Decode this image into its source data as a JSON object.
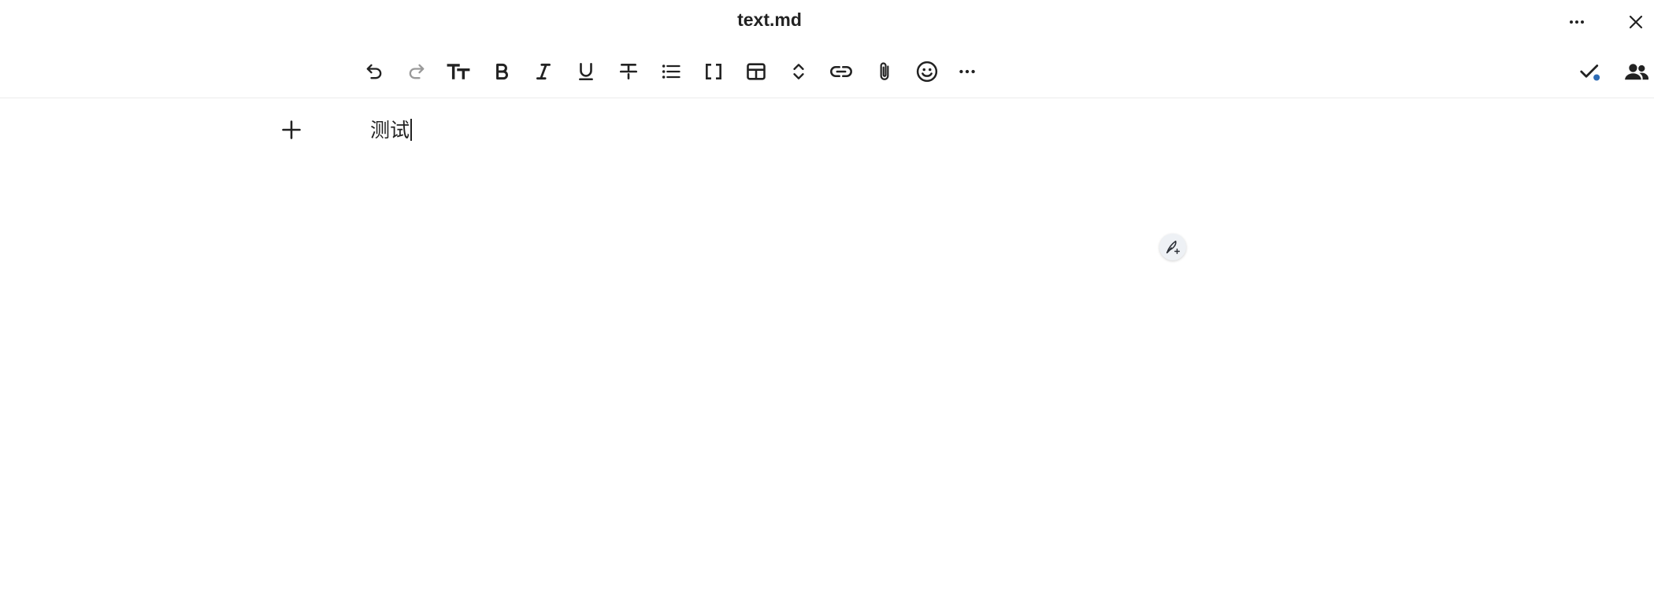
{
  "header": {
    "title": "text.md",
    "more_icon": "more-horizontal-icon",
    "close_icon": "close-icon"
  },
  "toolbar": {
    "items": [
      {
        "name": "undo",
        "icon": "undo-icon"
      },
      {
        "name": "redo",
        "icon": "redo-icon",
        "disabled": true
      },
      {
        "name": "headings",
        "icon": "text-size-icon"
      },
      {
        "name": "bold",
        "icon": "bold-icon"
      },
      {
        "name": "italic",
        "icon": "italic-icon"
      },
      {
        "name": "underline",
        "icon": "underline-icon"
      },
      {
        "name": "strikethrough",
        "icon": "strikethrough-icon"
      },
      {
        "name": "bullet-list",
        "icon": "list-icon"
      },
      {
        "name": "code-block",
        "icon": "brackets-icon"
      },
      {
        "name": "table",
        "icon": "table-icon"
      },
      {
        "name": "expand",
        "icon": "chevron-up-down-icon"
      },
      {
        "name": "link",
        "icon": "link-icon"
      },
      {
        "name": "attachment",
        "icon": "paperclip-icon"
      },
      {
        "name": "emoji",
        "icon": "emoji-icon"
      },
      {
        "name": "more",
        "icon": "more-horizontal-icon"
      }
    ],
    "status_icon": "check-sync-icon",
    "users_icon": "users-icon"
  },
  "editor": {
    "content": "测试",
    "add_icon": "plus-icon",
    "assistant_icon": "pen-sparkle-icon"
  },
  "colors": {
    "text": "#222222",
    "disabled": "#9a9a9a",
    "status_dot": "#2e6cb5",
    "divider": "#ececec"
  }
}
